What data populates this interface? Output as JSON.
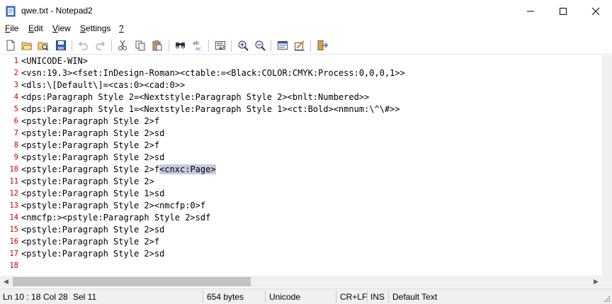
{
  "window": {
    "title": "qwe.txt - Notepad2",
    "minimize_glyph": "—",
    "maximize_glyph": "☐",
    "close_glyph": "✕"
  },
  "menu": {
    "items": [
      {
        "label": "File",
        "acc": "F",
        "rest": "ile"
      },
      {
        "label": "Edit",
        "acc": "E",
        "rest": "dit"
      },
      {
        "label": "View",
        "acc": "V",
        "rest": "iew"
      },
      {
        "label": "Settings",
        "acc": "S",
        "rest": "ettings"
      },
      {
        "label": "?",
        "acc": "?",
        "rest": ""
      }
    ]
  },
  "toolbar": {
    "buttons": [
      "new-icon",
      "open-icon",
      "browse-icon",
      "save-icon",
      "undo-icon",
      "redo-icon",
      "cut-icon",
      "copy-icon",
      "paste-icon",
      "find-icon",
      "replace-icon",
      "word-wrap-icon",
      "zoom-in-icon",
      "zoom-out-icon",
      "scheme-icon",
      "customize-schemes-icon",
      "exit-icon"
    ]
  },
  "editor": {
    "lines": [
      {
        "n": "1",
        "text": "<UNICODE-WIN>"
      },
      {
        "n": "2",
        "text": "<vsn:19.3><fset:InDesign-Roman><ctable:=<Black:COLOR:CMYK:Process:0,0,0,1>>"
      },
      {
        "n": "3",
        "text": "<dls:\\[Default\\]=<cas:0><cad:0>>"
      },
      {
        "n": "4",
        "text": "<dps:Paragraph Style 2=<Nextstyle:Paragraph Style 2><bnlt:Numbered>>"
      },
      {
        "n": "5",
        "text": "<dps:Paragraph Style 1=<Nextstyle:Paragraph Style 1><ct:Bold><nmnum:\\^\\#>>"
      },
      {
        "n": "6",
        "text": "<pstyle:Paragraph Style 2>f"
      },
      {
        "n": "7",
        "text": "<pstyle:Paragraph Style 2>sd"
      },
      {
        "n": "8",
        "text": "<pstyle:Paragraph Style 2>f"
      },
      {
        "n": "9",
        "text": "<pstyle:Paragraph Style 2>sd"
      },
      {
        "n": "10",
        "text": "<pstyle:Paragraph Style 2>f",
        "selected": "<cnxc:Page>"
      },
      {
        "n": "11",
        "text": "<pstyle:Paragraph Style 2>"
      },
      {
        "n": "12",
        "text": "<pstyle:Paragraph Style 1>sd"
      },
      {
        "n": "13",
        "text": "<pstyle:Paragraph Style 2><nmcfp:0>f"
      },
      {
        "n": "14",
        "text": "<nmcfp:><pstyle:Paragraph Style 2>sdf"
      },
      {
        "n": "15",
        "text": "<pstyle:Paragraph Style 2>sd"
      },
      {
        "n": "16",
        "text": "<pstyle:Paragraph Style 2>f"
      },
      {
        "n": "17",
        "text": "<pstyle:Paragraph Style 2>sd"
      },
      {
        "n": "18",
        "text": ""
      }
    ],
    "selection_color": "#c5cbe0",
    "line_number_color": "#d00000"
  },
  "status": {
    "position": "Ln 10 : 18",
    "column": "Col 28",
    "selection": "Sel 11",
    "size": "654 bytes",
    "encoding": "Unicode",
    "line_endings": "CR+LF",
    "insert_mode": "INS",
    "scheme": "Default Text"
  }
}
